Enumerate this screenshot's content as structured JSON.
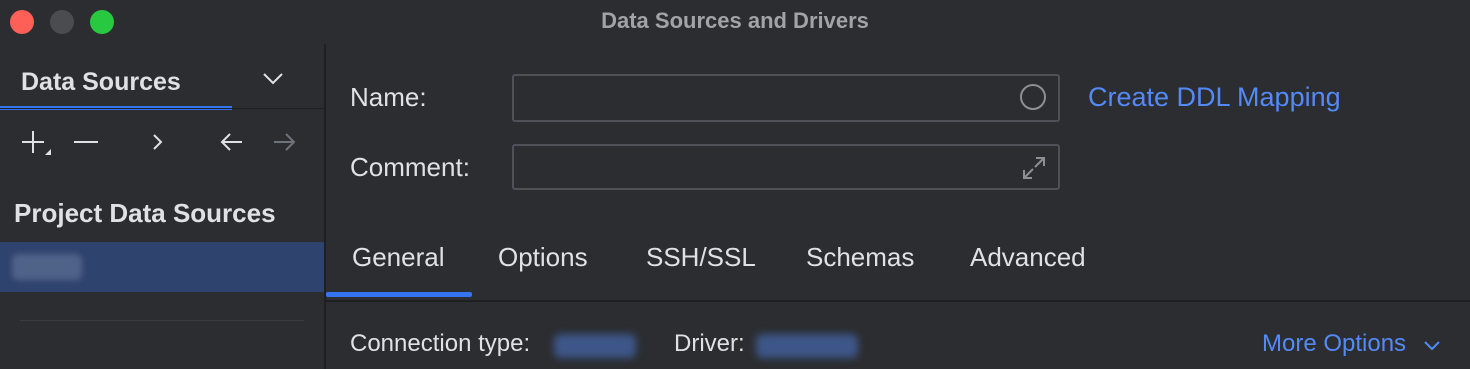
{
  "window": {
    "title": "Data Sources and Drivers",
    "traffic_lights": {
      "close": "#fe5f57",
      "minimize": "#4a4c50",
      "maximize": "#28c840"
    }
  },
  "sidebar": {
    "tab_label": "Data Sources",
    "toolbar": {
      "add_icon": "plus-icon",
      "remove_icon": "minus-icon",
      "navigate_icon": "chevron-right-icon",
      "back_icon": "arrow-left-icon",
      "forward_icon": "arrow-right-icon"
    },
    "section_title": "Project Data Sources"
  },
  "form": {
    "name_label": "Name:",
    "name_value": "",
    "comment_label": "Comment:",
    "comment_value": "",
    "ddl_link": "Create DDL Mapping"
  },
  "tabs": [
    "General",
    "Options",
    "SSH/SSL",
    "Schemas",
    "Advanced"
  ],
  "active_tab": "General",
  "general": {
    "connection_type_label": "Connection type:",
    "driver_label": "Driver:",
    "more_options": "More Options"
  },
  "colors": {
    "accent": "#3574f0",
    "link": "#548af7",
    "selection": "#2e436e"
  }
}
